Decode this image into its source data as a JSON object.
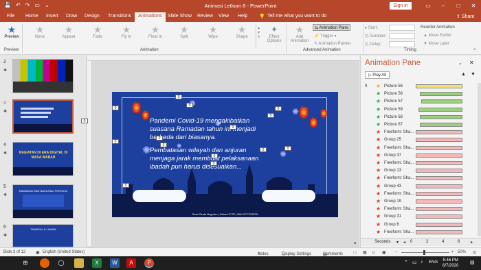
{
  "window": {
    "title": "Animasi Letkom 8 - PowerPoint",
    "sign_in": "Sign in",
    "share": "Share",
    "tell_me": "Tell me what you want to do"
  },
  "menu": {
    "tabs": [
      "File",
      "Home",
      "Insert",
      "Draw",
      "Design",
      "Transitions",
      "Animations",
      "Slide Show",
      "Review",
      "View",
      "Help"
    ]
  },
  "ribbon": {
    "preview": "Preview",
    "preview_group": "Preview",
    "animation_group": "Animation",
    "advanced_group": "Advanced Animation",
    "timing_group": "Timing",
    "effects": [
      "None",
      "Appear",
      "Fade",
      "Fly In",
      "Float In",
      "Split",
      "Wipe",
      "Shape"
    ],
    "effect_options": "Effect\nOptions",
    "add_animation": "Add\nAnimation",
    "animation_pane_btn": "Animation Pane",
    "trigger": "Trigger",
    "animation_painter": "Animation Painter",
    "start_label": "Start:",
    "duration_label": "Duration:",
    "delay_label": "Delay:",
    "reorder": "Reorder Animation",
    "move_earlier": "▲ Move Earlier",
    "move_later": "▼ Move Later"
  },
  "thumbnails": [
    {
      "num": "2"
    },
    {
      "num": "3"
    },
    {
      "num": "4",
      "text": "KEGIATAN DI ERA DIGITAL DI MASA WABAH"
    },
    {
      "num": "5",
      "text": "RAMADAN DAN NASIONAL PERCAYA"
    },
    {
      "num": "6",
      "text": "TANGKAL & LAWAN"
    }
  ],
  "slide": {
    "paragraph1_line1": "Pandemi Covid-19 mengakibatkan",
    "paragraph1_line2": "suasana Ramadan tahun ini menjadi",
    "paragraph1_line3": "berbeda dari biasanya.",
    "paragraph2_line1": "Pembatasan wilayah dan anjuran",
    "paragraph2_line2": "menjaga jarak membuat pelaksanaan",
    "paragraph2_line3": "ibadah pun harus disesuaikan...",
    "footer": "Dewi Cinda Nugroho | Kelas H7 BT | NIM 1P77G30T0",
    "tag_label": "0"
  },
  "pane": {
    "title": "Animation Pane",
    "play_all": "Play All",
    "rows": [
      {
        "num": "0",
        "name": "Picture 56",
        "type": "entrance-gold",
        "bar_color": "#f4e06a"
      },
      {
        "num": "",
        "name": "Picture 58",
        "type": "entrance",
        "bar_color": "#9ccf7d"
      },
      {
        "num": "",
        "name": "Picture 57",
        "type": "entrance",
        "bar_color": "#9ccf7d"
      },
      {
        "num": "",
        "name": "Picture 59",
        "type": "entrance",
        "bar_color": "#9ccf7d"
      },
      {
        "num": "",
        "name": "Picture 68",
        "type": "entrance",
        "bar_color": "#9ccf7d"
      },
      {
        "num": "",
        "name": "Picture 67",
        "type": "entrance",
        "bar_color": "#9ccf7d"
      },
      {
        "num": "",
        "name": "Freeform: Sha...",
        "type": "exit",
        "bar_color": "#f5b8b8"
      },
      {
        "num": "",
        "name": "Group 25",
        "type": "exit",
        "bar_color": "#f5b8b8"
      },
      {
        "num": "",
        "name": "Freeform: Sha...",
        "type": "exit",
        "bar_color": "#f5b8b8"
      },
      {
        "num": "",
        "name": "Group 37",
        "type": "exit",
        "bar_color": "#f5b8b8"
      },
      {
        "num": "",
        "name": "Freeform: Sha...",
        "type": "exit",
        "bar_color": "#f5b8b8"
      },
      {
        "num": "",
        "name": "Group 13",
        "type": "exit",
        "bar_color": "#f5b8b8"
      },
      {
        "num": "",
        "name": "Freeform: Sha...",
        "type": "exit",
        "bar_color": "#f5b8b8"
      },
      {
        "num": "",
        "name": "Group 43",
        "type": "exit",
        "bar_color": "#f5b8b8"
      },
      {
        "num": "",
        "name": "Freeform: Sha...",
        "type": "exit",
        "bar_color": "#f5b8b8"
      },
      {
        "num": "",
        "name": "Group 19",
        "type": "exit",
        "bar_color": "#f5b8b8"
      },
      {
        "num": "",
        "name": "Freeform: Sha...",
        "type": "exit",
        "bar_color": "#f5b8b8"
      },
      {
        "num": "",
        "name": "Group 31",
        "type": "exit",
        "bar_color": "#f5b8b8"
      },
      {
        "num": "",
        "name": "Group 6",
        "type": "exit",
        "bar_color": "#f5b8b8"
      },
      {
        "num": "",
        "name": "Freeform: Sha...",
        "type": "exit",
        "bar_color": "#f5b8b8"
      }
    ],
    "seconds_label": "Seconds",
    "timeline_ticks": [
      "0",
      "2",
      "4",
      "6"
    ]
  },
  "status": {
    "slide_of": "Slide 3 of 12",
    "language": "English (United States)",
    "notes": "Notes",
    "display_settings": "Display Settings",
    "comments": "Comments",
    "zoom": "50%"
  },
  "taskbar": {
    "time": "5:46 PM",
    "date": "6/7/2020",
    "lang": "ENG"
  },
  "colors": {
    "accent": "#b7472a",
    "slide_bg": "#1d3f9e",
    "entrance_star": "#3aa24a",
    "exit_star": "#d9342b",
    "gold_star": "#e6b422"
  }
}
